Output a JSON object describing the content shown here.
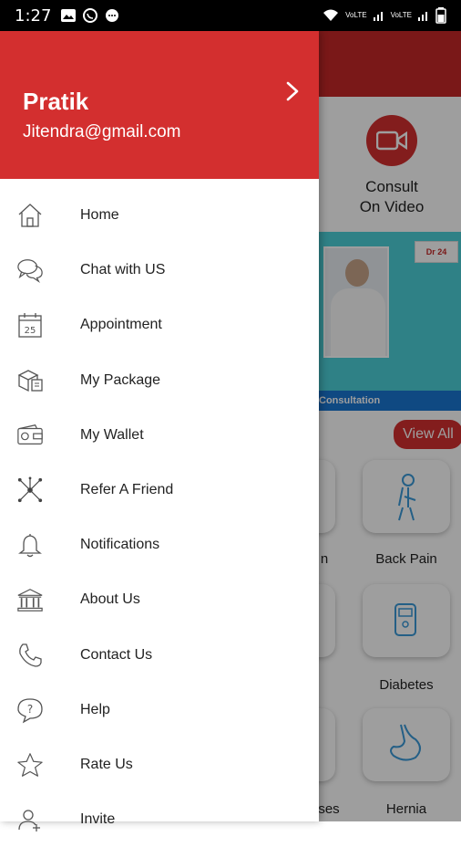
{
  "status_bar": {
    "time": "1:27",
    "net1": "VoLTE",
    "net2": "VoLTE"
  },
  "drawer": {
    "user_name": "Pratik",
    "user_email": "Jitendra@gmail.com",
    "menu": [
      {
        "label": "Home",
        "icon": "home-icon"
      },
      {
        "label": "Chat with US",
        "icon": "chat-icon"
      },
      {
        "label": "Appointment",
        "icon": "calendar-icon",
        "icon_text": "25"
      },
      {
        "label": "My Package",
        "icon": "package-icon"
      },
      {
        "label": "My Wallet",
        "icon": "wallet-icon"
      },
      {
        "label": "Refer A Friend",
        "icon": "share-network-icon"
      },
      {
        "label": "Notifications",
        "icon": "bell-icon"
      },
      {
        "label": "About Us",
        "icon": "bank-icon"
      },
      {
        "label": "Contact Us",
        "icon": "phone-icon"
      },
      {
        "label": "Help",
        "icon": "help-icon"
      },
      {
        "label": "Rate Us",
        "icon": "star-icon"
      },
      {
        "label": "Invite",
        "icon": "invite-icon"
      }
    ]
  },
  "background": {
    "consult_label": "Consult\nOn Video",
    "banner_logo": "Dr 24",
    "banner_strip": "Consultation",
    "view_all": "View All",
    "cards": [
      "n",
      "Back Pain",
      "Diabetes",
      "ses",
      "Hernia"
    ]
  },
  "colors": {
    "brand_red": "#d32f2f",
    "header_dark_red": "#c62828",
    "banner_teal": "#4dd0d8",
    "strip_blue": "#1976d2"
  }
}
